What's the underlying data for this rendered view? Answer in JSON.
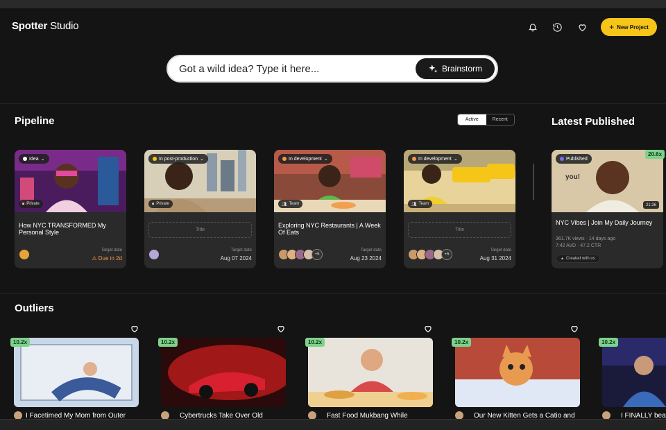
{
  "app": {
    "brand_bold": "Spotter",
    "brand_rest": "Studio"
  },
  "header": {
    "icons": [
      "bell-icon",
      "history-icon",
      "heart-icon"
    ],
    "new_project_label": "New Project",
    "accent": "#f5c518"
  },
  "search": {
    "placeholder": "Got a wild idea? Type it here...",
    "button_label": "Brainstorm"
  },
  "pipeline": {
    "title": "Pipeline",
    "toggle": {
      "active": "Active",
      "recent": "Recent",
      "selected": "Active"
    },
    "cards": [
      {
        "status": "Idea",
        "status_color": "#ffffff",
        "visibility": "Private",
        "title": "How NYC TRANSFORMED My Personal Style",
        "target_label": "Target date",
        "target_value": "Due in 2d",
        "overdue": true
      },
      {
        "status": "In post-production",
        "status_color": "#f5c518",
        "visibility": "Private",
        "title_placeholder": "Title",
        "target_label": "Target date",
        "target_value": "Aug 07 2024"
      },
      {
        "status": "In development",
        "status_color": "#f2994a",
        "visibility": "Team",
        "title": "Exploring NYC Restaurants | A Week Of Eats",
        "target_label": "Target date",
        "target_value": "Aug 23 2024",
        "more_avatars": "+5"
      },
      {
        "status": "In development",
        "status_color": "#f2994a",
        "visibility": "Team",
        "title_placeholder": "Title",
        "target_label": "Target date",
        "target_value": "Aug 31 2024",
        "more_avatars": "+5"
      }
    ]
  },
  "published": {
    "title": "Latest Published",
    "card": {
      "badge": "20.6x",
      "status": "Published",
      "status_color": "#7c6cf0",
      "duration": "21:36",
      "title": "NYC Vibes | Join My Daily Journey",
      "views": "361.7K views",
      "age": "14 days ago",
      "avd": "7:42 AVD",
      "ctr": "47.2 CTR",
      "created_with": "Created with us"
    }
  },
  "outliers": {
    "title": "Outliers",
    "items": [
      {
        "badge": "10.2x",
        "title": "I Facetimed My Mom from Outer"
      },
      {
        "badge": "10.2x",
        "title": "Cybertrucks Take Over Old"
      },
      {
        "badge": "10.2x",
        "title": "Fast Food Mukbang While"
      },
      {
        "badge": "10.2x",
        "title": "Our New Kitten Gets a Catio and"
      },
      {
        "badge": "10.2x",
        "title": "I FINALLY beat"
      }
    ]
  }
}
